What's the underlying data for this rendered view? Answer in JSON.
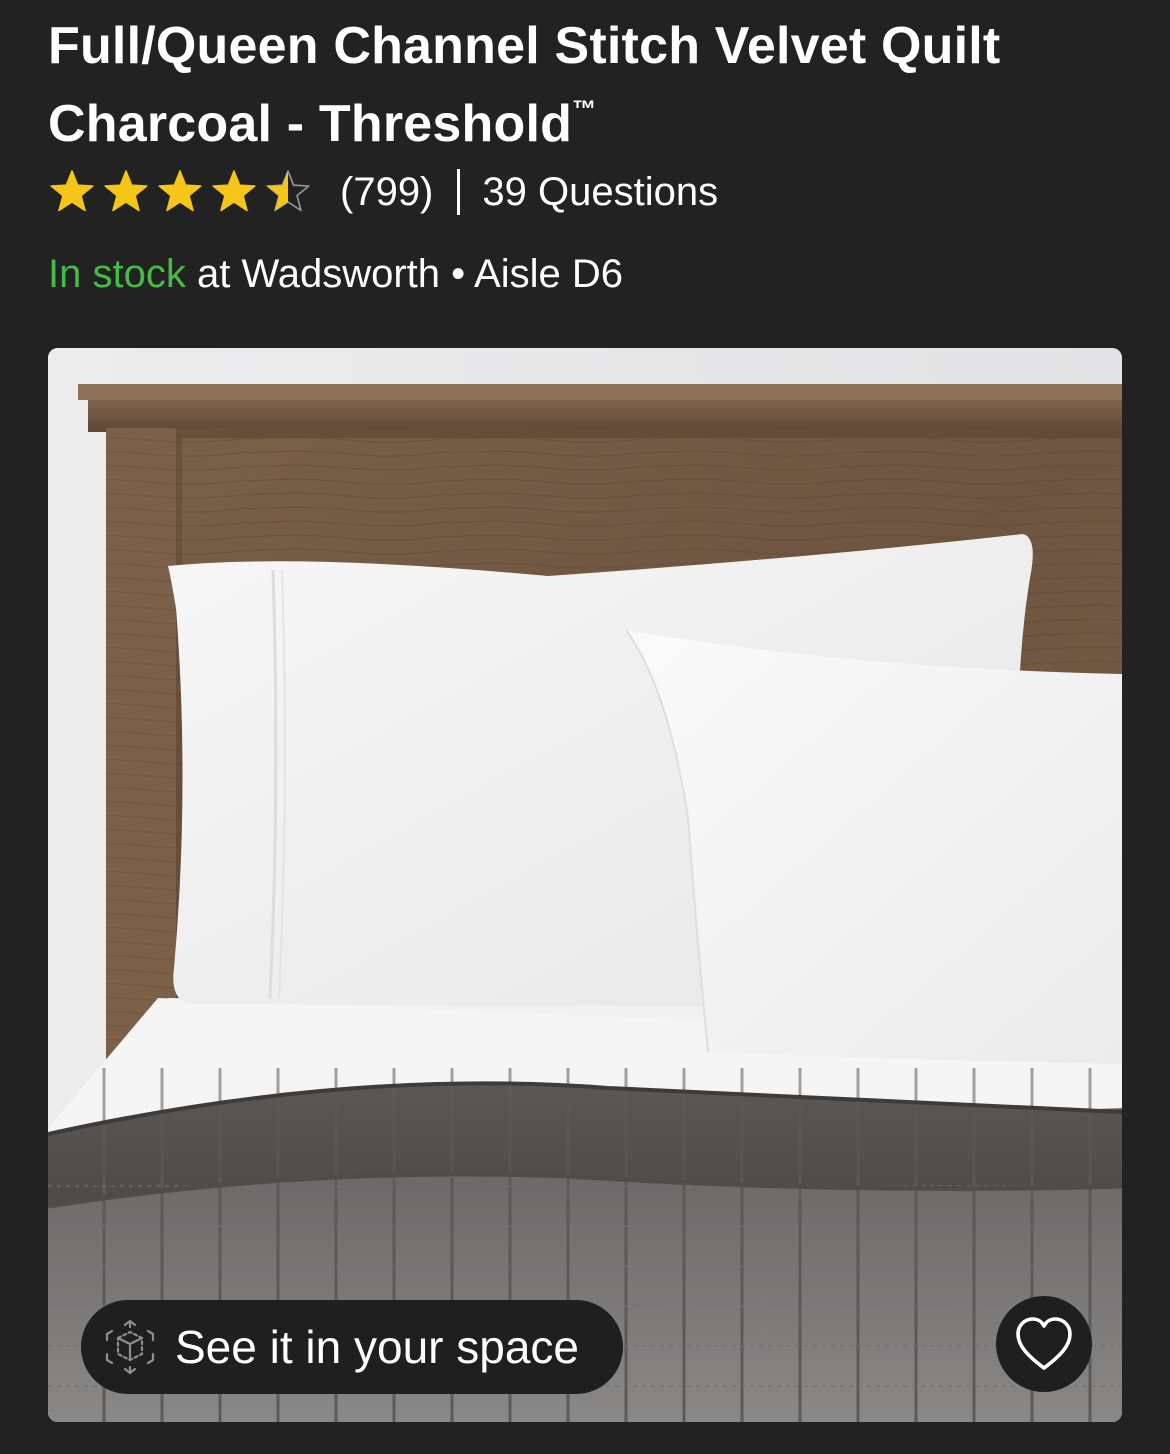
{
  "product": {
    "title": "Full/Queen Channel Stitch Velvet Quilt Charcoal - Threshold",
    "trademark": "™",
    "rating": 4.5,
    "rating_max": 5,
    "review_count": "(799)",
    "questions": "39 Questions"
  },
  "availability": {
    "status": "In stock",
    "location": "at Wadsworth • Aisle D6"
  },
  "image": {
    "ar_button_label": "See it in your space",
    "favorite_icon": "heart-icon",
    "ar_icon": "3d-cube-icon"
  },
  "colors": {
    "background": "#222222",
    "star": "#f5c518",
    "in_stock": "#46b946",
    "button_bg": "#1f1f1f"
  }
}
